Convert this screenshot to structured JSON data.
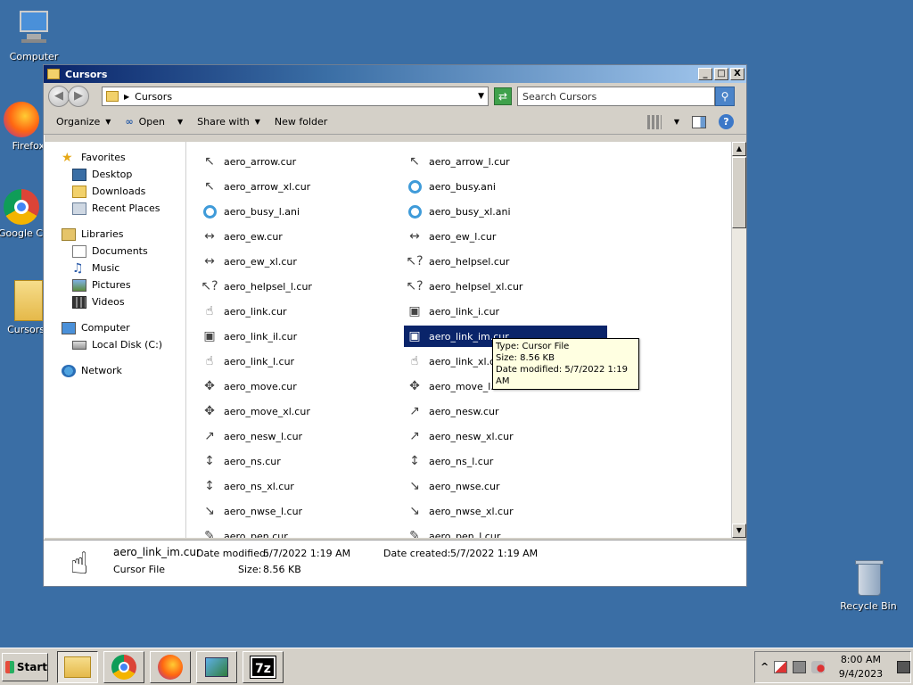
{
  "desktop": {
    "icons": [
      {
        "label": "Computer"
      },
      {
        "label": "Firefox"
      },
      {
        "label": "Google Chrome"
      },
      {
        "label": "Cursors"
      },
      {
        "label": "Recycle Bin"
      }
    ]
  },
  "window": {
    "title": "Cursors",
    "controls": {
      "minimize": "_",
      "maximize": "□",
      "close": "X"
    },
    "address": {
      "path": "Cursors"
    },
    "search": {
      "placeholder": "Search Cursors"
    },
    "toolbar": {
      "organize": "Organize",
      "open": "Open",
      "share_with": "Share with",
      "new_folder": "New folder"
    },
    "nav": {
      "favorites": "Favorites",
      "favorites_items": [
        "Desktop",
        "Downloads",
        "Recent Places"
      ],
      "libraries": "Libraries",
      "libraries_items": [
        "Documents",
        "Music",
        "Pictures",
        "Videos"
      ],
      "computer": "Computer",
      "computer_items": [
        "Local Disk (C:)"
      ],
      "network": "Network"
    },
    "files": [
      {
        "name": "aero_arrow.cur",
        "icon": "arrow-icon"
      },
      {
        "name": "aero_arrow_l.cur",
        "icon": "arrow-icon"
      },
      {
        "name": "aero_arrow_xl.cur",
        "icon": "arrow-icon"
      },
      {
        "name": "aero_busy.ani",
        "icon": "busy-ring-icon"
      },
      {
        "name": "aero_busy_l.ani",
        "icon": "busy-ring-icon"
      },
      {
        "name": "aero_busy_xl.ani",
        "icon": "busy-ring-icon"
      },
      {
        "name": "aero_ew.cur",
        "icon": "resize-ew-icon"
      },
      {
        "name": "aero_ew_l.cur",
        "icon": "resize-ew-icon"
      },
      {
        "name": "aero_ew_xl.cur",
        "icon": "resize-ew-icon"
      },
      {
        "name": "aero_helpsel.cur",
        "icon": "help-select-icon"
      },
      {
        "name": "aero_helpsel_l.cur",
        "icon": "help-select-icon"
      },
      {
        "name": "aero_helpsel_xl.cur",
        "icon": "help-select-icon"
      },
      {
        "name": "aero_link.cur",
        "icon": "hand-icon"
      },
      {
        "name": "aero_link_i.cur",
        "icon": "link-image-icon"
      },
      {
        "name": "aero_link_il.cur",
        "icon": "link-image-icon"
      },
      {
        "name": "aero_link_im.cur",
        "icon": "link-image-icon"
      },
      {
        "name": "aero_link_l.cur",
        "icon": "hand-icon"
      },
      {
        "name": "aero_link_xl.cur",
        "icon": "hand-icon"
      },
      {
        "name": "aero_move.cur",
        "icon": "move-icon"
      },
      {
        "name": "aero_move_l.cur",
        "icon": "move-icon"
      },
      {
        "name": "aero_move_xl.cur",
        "icon": "move-icon"
      },
      {
        "name": "aero_nesw.cur",
        "icon": "resize-nesw-icon"
      },
      {
        "name": "aero_nesw_l.cur",
        "icon": "resize-nesw-icon"
      },
      {
        "name": "aero_nesw_xl.cur",
        "icon": "resize-nesw-icon"
      },
      {
        "name": "aero_ns.cur",
        "icon": "resize-ns-icon"
      },
      {
        "name": "aero_ns_l.cur",
        "icon": "resize-ns-icon"
      },
      {
        "name": "aero_ns_xl.cur",
        "icon": "resize-ns-icon"
      },
      {
        "name": "aero_nwse.cur",
        "icon": "resize-nwse-icon"
      },
      {
        "name": "aero_nwse_l.cur",
        "icon": "resize-nwse-icon"
      },
      {
        "name": "aero_nwse_xl.cur",
        "icon": "resize-nwse-icon"
      },
      {
        "name": "aero_pen.cur",
        "icon": "pen-icon"
      },
      {
        "name": "aero_pen_l.cur",
        "icon": "pen-icon"
      }
    ],
    "selected_file": "aero_link_im.cur",
    "tooltip": {
      "type": "Type: Cursor File",
      "size": "Size: 8.56 KB",
      "modified": "Date modified: 5/7/2022 1:19 AM"
    },
    "details": {
      "name": "aero_link_im.cur",
      "type": "Cursor File",
      "date_modified_label": "Date modified:",
      "date_modified": "5/7/2022 1:19 AM",
      "size_label": "Size:",
      "size": "8.56 KB",
      "date_created_label": "Date created:",
      "date_created": "5/7/2022 1:19 AM"
    }
  },
  "taskbar": {
    "start": "Start",
    "clock_time": "8:00 AM",
    "clock_date": "9/4/2023",
    "seven_zip": "7z",
    "tray_expand": "^"
  }
}
